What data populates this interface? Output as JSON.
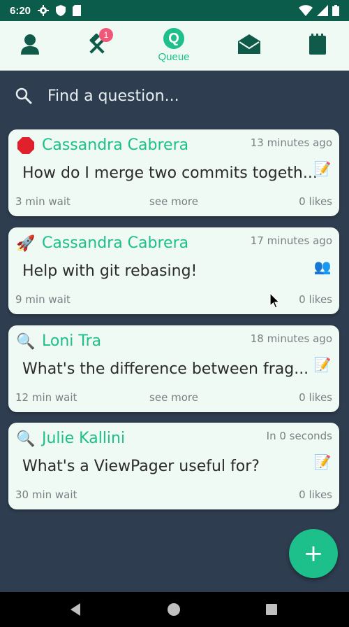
{
  "status_bar": {
    "time": "6:20",
    "bg_color": "#0b5c4a"
  },
  "tabs": [
    {
      "name": "profile",
      "icon": "person-icon"
    },
    {
      "name": "tools",
      "icon": "hammer-icon",
      "badge": "1"
    },
    {
      "name": "queue",
      "icon": "queue-logo",
      "logo_text": "Q",
      "label": "Queue",
      "active": true
    },
    {
      "name": "inbox",
      "icon": "envelope-open-icon"
    },
    {
      "name": "notes",
      "icon": "notepad-icon"
    }
  ],
  "search": {
    "placeholder": "Find a question..."
  },
  "cards": [
    {
      "emoji": "🛑",
      "emoji_icon": "stop-sign-icon",
      "name": "Cassandra Cabrera",
      "time": "13 minutes ago",
      "question": "How do I merge two commits togeth...",
      "status_icon": "memo-icon",
      "status_emoji": "📝",
      "wait": "3 min wait",
      "see_more": "see more",
      "likes": "0 likes"
    },
    {
      "emoji": "🚀",
      "emoji_icon": "rocket-icon",
      "name": "Cassandra Cabrera",
      "time": "17 minutes ago",
      "question": "Help with git rebasing!",
      "status_icon": "people-icon",
      "status_emoji": "👥",
      "wait": "9 min wait",
      "see_more": "",
      "likes": "0 likes"
    },
    {
      "emoji": "🔍",
      "emoji_icon": "magnifier-icon",
      "name": "Loni Tra",
      "time": "18 minutes ago",
      "question": "What's the difference between frag...",
      "status_icon": "memo-icon",
      "status_emoji": "📝",
      "wait": "12 min wait",
      "see_more": "see more",
      "likes": "0 likes"
    },
    {
      "emoji": "🔍",
      "emoji_icon": "magnifier-icon",
      "name": "Julie Kallini",
      "time": "In 0 seconds",
      "question": "What's a ViewPager useful for?",
      "status_icon": "memo-icon",
      "status_emoji": "📝",
      "wait": "30 min wait",
      "see_more": "",
      "likes": "0 likes"
    }
  ],
  "fab": {
    "label": "+",
    "icon": "plus-icon"
  },
  "colors": {
    "accent": "#1dbf8a",
    "background": "#2e3d4f",
    "card": "#effaf5",
    "badge": "#f0587a",
    "icon_dark": "#0f5a48"
  }
}
